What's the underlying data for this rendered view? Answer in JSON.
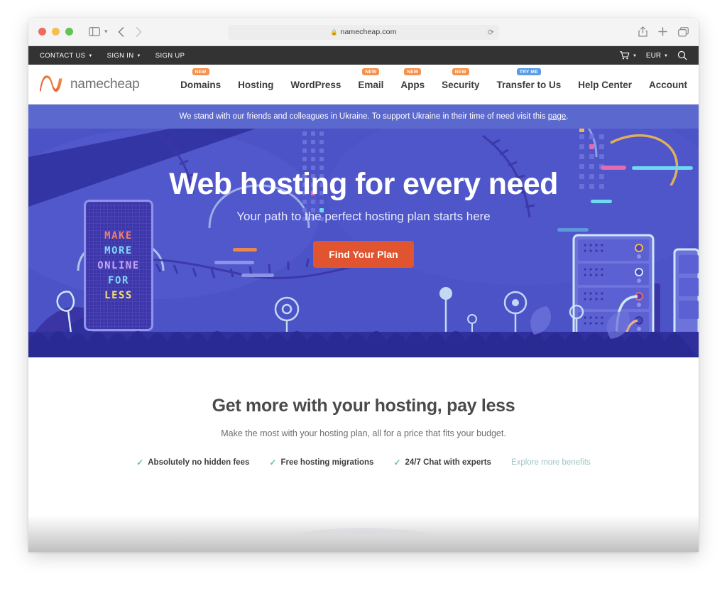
{
  "browser": {
    "url": "namecheap.com",
    "lock_icon": "lock-icon",
    "reload_icon": "reload-icon",
    "sidebar_icon": "sidebar-toggle-icon",
    "back_icon": "back-arrow-icon",
    "forward_icon": "forward-arrow-icon",
    "shield_icon": "privacy-shield-icon",
    "share_icon": "share-icon",
    "newtab_icon": "plus-icon",
    "tabs_icon": "tab-overview-icon"
  },
  "topbar": {
    "links": [
      {
        "label": "CONTACT US",
        "has_caret": true
      },
      {
        "label": "SIGN IN",
        "has_caret": true
      },
      {
        "label": "SIGN UP",
        "has_caret": false
      }
    ],
    "cart_icon": "cart-icon",
    "currency": "EUR",
    "search_icon": "search-icon"
  },
  "mainnav": {
    "logo_text": "namecheap",
    "logo_mark": "namecheap-logo-icon",
    "items": [
      {
        "label": "Domains",
        "badge": "NEW",
        "badge_type": "new"
      },
      {
        "label": "Hosting",
        "badge": "",
        "badge_type": ""
      },
      {
        "label": "WordPress",
        "badge": "",
        "badge_type": ""
      },
      {
        "label": "Email",
        "badge": "NEW",
        "badge_type": "new"
      },
      {
        "label": "Apps",
        "badge": "NEW",
        "badge_type": "new"
      },
      {
        "label": "Security",
        "badge": "NEW",
        "badge_type": "new"
      },
      {
        "label": "Transfer to Us",
        "badge": "TRY ME",
        "badge_type": "try"
      },
      {
        "label": "Help Center",
        "badge": "",
        "badge_type": ""
      },
      {
        "label": "Account",
        "badge": "",
        "badge_type": ""
      }
    ]
  },
  "ukraine_banner": {
    "flag_icon": "ukraine-flag-icon",
    "text_before": "We stand with our friends and colleagues in Ukraine. To support Ukraine in their time of need visit this ",
    "link_text": "page",
    "text_after": "."
  },
  "hero": {
    "heading": "Web hosting for every need",
    "subheading": "Your path to the perfect hosting plan starts here",
    "cta_label": "Find Your Plan",
    "sign_lines": [
      "MAKE",
      "MORE",
      "ONLINE",
      "FOR",
      "LESS"
    ]
  },
  "section": {
    "heading": "Get more with your hosting, pay less",
    "subheading": "Make the most with your hosting plan, all for a price that fits your budget.",
    "benefits": [
      "Absolutely no hidden fees",
      "Free hosting migrations",
      "24/7 Chat with experts"
    ],
    "more_link": "Explore more benefits",
    "check_glyph": "✓"
  },
  "colors": {
    "topbar_bg": "#333333",
    "hero_bg": "#4c53c7",
    "cta": "#e0542f",
    "badge_new": "#f5924e",
    "badge_try": "#5b9ce6",
    "ua_banner": "#5b68ce",
    "check": "#5fbfae",
    "link": "#9cc6c2",
    "logo_orange": "#e5573f"
  }
}
